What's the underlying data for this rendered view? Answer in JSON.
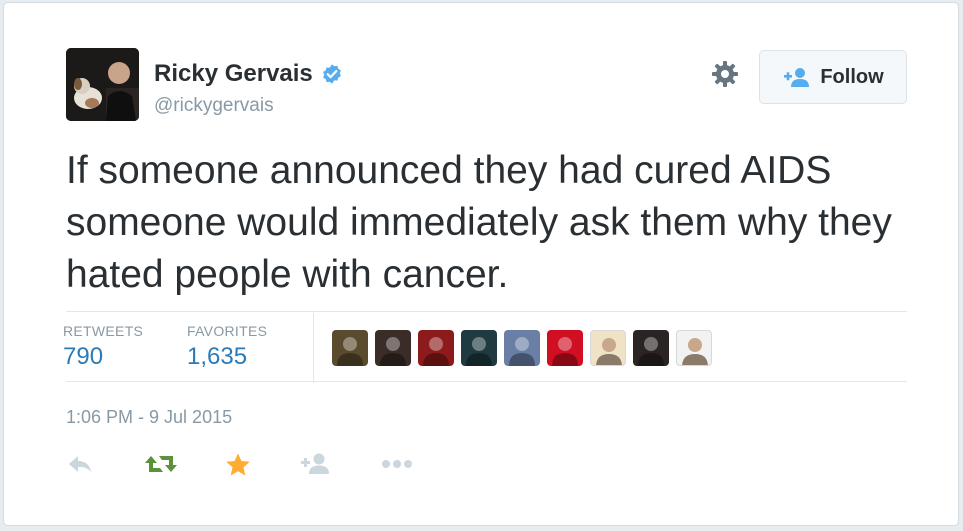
{
  "tweet": {
    "author": {
      "name": "Ricky Gervais",
      "handle": "@rickygervais",
      "verified": true
    },
    "text": "If someone announced they had cured AIDS someone would immediately ask them why they hated people with cancer.",
    "follow_label": "Follow",
    "stats": {
      "retweets_label": "RETWEETS",
      "retweets_value": "790",
      "favorites_label": "FAVORITES",
      "favorites_value": "1,635"
    },
    "favoriters": [
      {
        "icon": "favoriter-avatar-1",
        "color": "#5a4a2e"
      },
      {
        "icon": "favoriter-avatar-2",
        "color": "#3a2c27"
      },
      {
        "icon": "favoriter-avatar-3",
        "color": "#8e1b1b"
      },
      {
        "icon": "favoriter-avatar-4",
        "color": "#1f3a40"
      },
      {
        "icon": "favoriter-avatar-5",
        "color": "#6a7fa6"
      },
      {
        "icon": "favoriter-avatar-6",
        "color": "#d10f22"
      },
      {
        "icon": "favoriter-avatar-7",
        "color": "#efe2c6"
      },
      {
        "icon": "favoriter-avatar-8",
        "color": "#2a2424"
      },
      {
        "icon": "favoriter-avatar-9",
        "color": "#f2f2f2"
      }
    ],
    "timestamp": "1:06 PM - 9 Jul 2015",
    "colors": {
      "accent": "#2b7bb9",
      "verified": "#55acee",
      "retweeted": "#5c913b",
      "favorited": "#ffac33",
      "muted": "#8899a6",
      "text": "#292f33"
    },
    "actions": [
      "reply-icon",
      "retweet-icon",
      "favorite-icon",
      "follow-icon",
      "more-icon"
    ]
  }
}
